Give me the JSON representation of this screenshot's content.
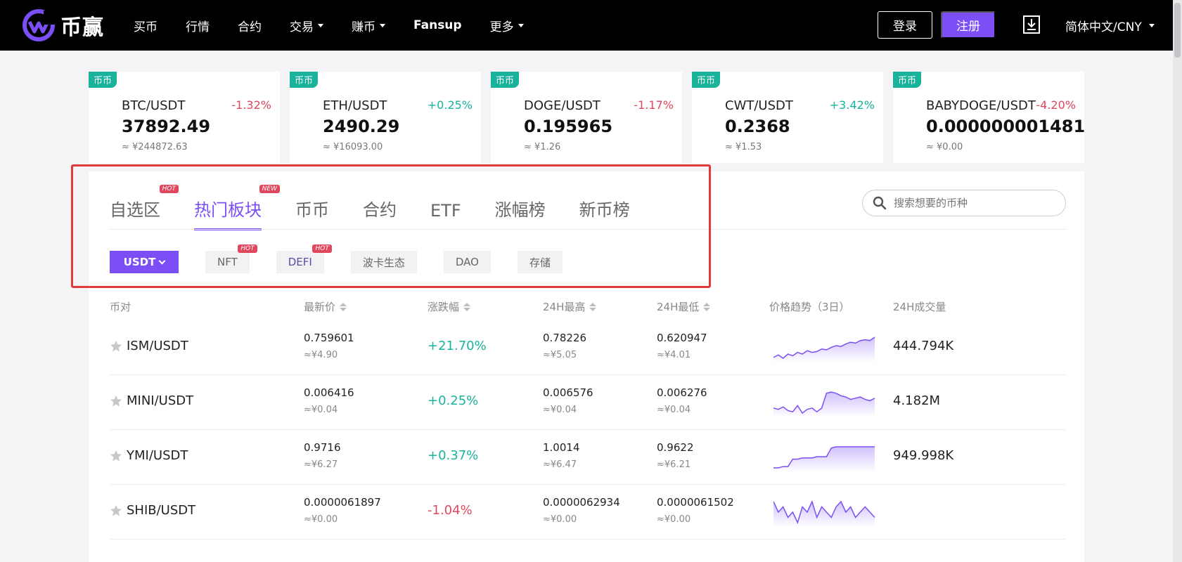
{
  "nav": {
    "logo_text": "币赢",
    "items": [
      {
        "label": "买币",
        "dropdown": false
      },
      {
        "label": "行情",
        "dropdown": false
      },
      {
        "label": "合约",
        "dropdown": false
      },
      {
        "label": "交易",
        "dropdown": true
      },
      {
        "label": "赚币",
        "dropdown": true
      },
      {
        "label": "Fansup",
        "dropdown": false
      },
      {
        "label": "更多",
        "dropdown": true
      }
    ],
    "login": "登录",
    "register": "注册",
    "language": "简体中文/CNY"
  },
  "tickers": [
    {
      "tag": "币币",
      "pair": "BTC/USDT",
      "change": "-1.32%",
      "dir": "down",
      "price": "37892.49",
      "cny": "≈ ¥244872.63"
    },
    {
      "tag": "币币",
      "pair": "ETH/USDT",
      "change": "+0.25%",
      "dir": "up",
      "price": "2490.29",
      "cny": "≈ ¥16093.00"
    },
    {
      "tag": "币币",
      "pair": "DOGE/USDT",
      "change": "-1.17%",
      "dir": "down",
      "price": "0.195965",
      "cny": "≈ ¥1.26"
    },
    {
      "tag": "币币",
      "pair": "CWT/USDT",
      "change": "+3.42%",
      "dir": "up",
      "price": "0.2368",
      "cny": "≈ ¥1.53"
    },
    {
      "tag": "币币",
      "pair": "BABYDOGE/USDT",
      "change": "-4.20%",
      "dir": "down",
      "price": "0.000000001481",
      "cny": "≈ ¥0.00"
    }
  ],
  "tabs": [
    {
      "label": "自选区",
      "badge": "HOT",
      "active": false
    },
    {
      "label": "热门板块",
      "badge": "NEW",
      "active": true
    },
    {
      "label": "币币",
      "badge": "",
      "active": false
    },
    {
      "label": "合约",
      "badge": "",
      "active": false
    },
    {
      "label": "ETF",
      "badge": "",
      "active": false
    },
    {
      "label": "涨幅榜",
      "badge": "",
      "active": false
    },
    {
      "label": "新币榜",
      "badge": "",
      "active": false
    }
  ],
  "search": {
    "placeholder": "搜索想要的币种"
  },
  "subtabs": [
    {
      "label": "USDT",
      "badge": "",
      "primary": true
    },
    {
      "label": "NFT",
      "badge": "HOT",
      "primary": false
    },
    {
      "label": "DEFI",
      "badge": "HOT",
      "primary": false
    },
    {
      "label": "波卡生态",
      "badge": "",
      "primary": false
    },
    {
      "label": "DAO",
      "badge": "",
      "primary": false
    },
    {
      "label": "存储",
      "badge": "",
      "primary": false
    }
  ],
  "table": {
    "headers": {
      "pair": "币对",
      "last": "最新价",
      "change": "涨跌幅",
      "high": "24H最高",
      "low": "24H最低",
      "trend": "价格趋势（3日）",
      "volume": "24H成交量"
    },
    "rows": [
      {
        "pair": "ISM/USDT",
        "last": "0.759601",
        "last_cny": "≈¥4.90",
        "change": "+21.70%",
        "dir": "up",
        "high": "0.78226",
        "high_cny": "≈¥5.05",
        "low": "0.620947",
        "low_cny": "≈¥4.01",
        "volume": "444.794K",
        "trend": [
          6,
          9,
          5,
          10,
          8,
          12,
          10,
          14,
          12,
          13,
          16,
          15,
          18,
          20,
          19,
          22,
          24,
          23,
          26,
          27,
          26,
          30
        ]
      },
      {
        "pair": "MINI/USDT",
        "last": "0.006416",
        "last_cny": "≈¥0.04",
        "change": "+0.25%",
        "dir": "up",
        "high": "0.006576",
        "high_cny": "≈¥0.04",
        "low": "0.006276",
        "low_cny": "≈¥0.04",
        "volume": "4.182M",
        "trend": [
          12,
          11,
          13,
          10,
          9,
          14,
          8,
          11,
          12,
          9,
          12,
          24,
          25,
          24,
          22,
          21,
          19,
          20,
          21,
          19,
          18,
          20
        ]
      },
      {
        "pair": "YMI/USDT",
        "last": "0.9716",
        "last_cny": "≈¥6.27",
        "change": "+0.37%",
        "dir": "up",
        "high": "1.0014",
        "high_cny": "≈¥6.47",
        "low": "0.9622",
        "low_cny": "≈¥6.21",
        "volume": "949.998K",
        "trend": [
          8,
          8,
          9,
          9,
          15,
          15,
          16,
          16,
          16,
          17,
          17,
          17,
          24,
          25,
          25,
          25,
          25,
          25,
          25,
          25,
          25,
          25
        ]
      },
      {
        "pair": "SHIB/USDT",
        "last": "0.0000061897",
        "last_cny": "≈¥0.00",
        "change": "-1.04%",
        "dir": "down",
        "high": "0.0000062934",
        "high_cny": "≈¥0.00",
        "low": "0.0000061502",
        "low_cny": "≈¥0.00",
        "volume": "",
        "trend": [
          20,
          18,
          19,
          17,
          18,
          16,
          19,
          18,
          20,
          17,
          19,
          18,
          17,
          19,
          20,
          18,
          19,
          17,
          18,
          19,
          18,
          17
        ]
      }
    ]
  },
  "colors": {
    "accent": "#7b4ff5",
    "up": "#18b39a",
    "down": "#e0475d",
    "highlight": "#e23a3a"
  }
}
